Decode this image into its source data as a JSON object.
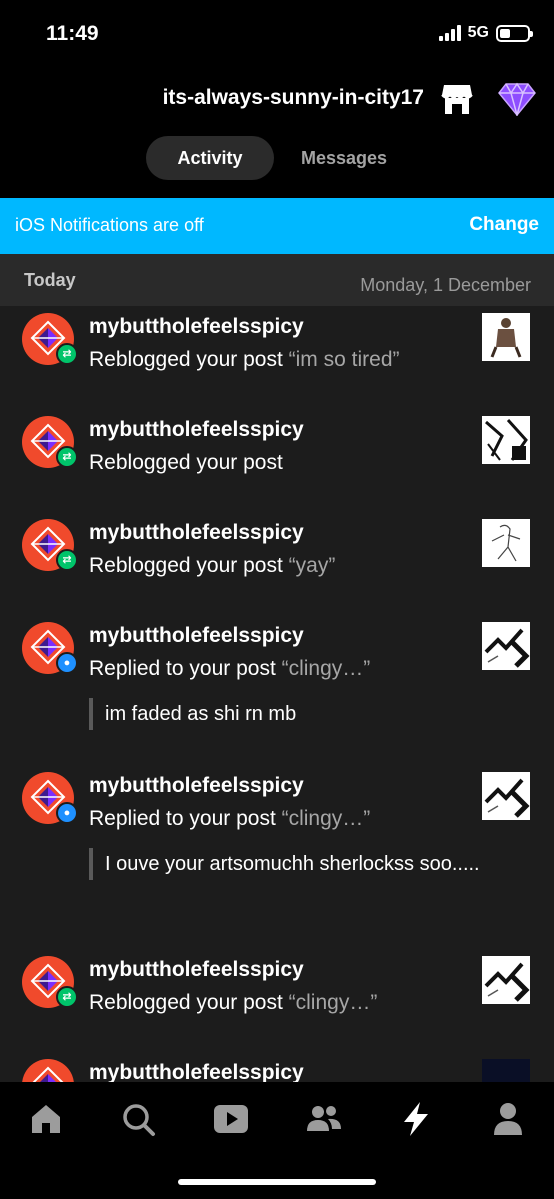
{
  "status_bar": {
    "time": "11:49",
    "network": "5G"
  },
  "header": {
    "blog_name": "its-always-sunny-in-city17",
    "shop_icon": "shop-icon",
    "premium_icon": "gem-icon"
  },
  "tabs": [
    {
      "label": "Activity",
      "active": true
    },
    {
      "label": "Messages",
      "active": false
    }
  ],
  "notifications_banner": {
    "text": "iOS Notifications are off",
    "action": "Change"
  },
  "activity": {
    "day_label": "Today",
    "date_label": "Monday, 1 December",
    "items": [
      {
        "username": "mybuttholefeelsspicy",
        "type": "reblog",
        "action": "Reblogged your post ",
        "quote": "“im so tired”"
      },
      {
        "username": "mybuttholefeelsspicy",
        "type": "reblog",
        "action": "Reblogged your post",
        "quote": ""
      },
      {
        "username": "mybuttholefeelsspicy",
        "type": "reblog",
        "action": "Reblogged your post ",
        "quote": "“yay”"
      },
      {
        "username": "mybuttholefeelsspicy",
        "type": "reply",
        "action": "Replied to your post ",
        "quote": "“clingy…”",
        "reply": "im faded as shi rn mb"
      },
      {
        "username": "mybuttholefeelsspicy",
        "type": "reply",
        "action": "Replied to your post ",
        "quote": "“clingy…”",
        "reply": "I ouve your artsomuchh sherlockss soo....."
      },
      {
        "username": "mybuttholefeelsspicy",
        "type": "reblog",
        "action": "Reblogged your post ",
        "quote": "“clingy…”"
      },
      {
        "username": "mybuttholefeelsspicy",
        "type": "reblog",
        "action": "",
        "quote": ""
      }
    ]
  },
  "bottom_nav": [
    "home-icon",
    "search-icon",
    "video-icon",
    "communities-icon",
    "activity-icon",
    "account-icon"
  ],
  "colors": {
    "banner": "#00b8ff",
    "avatar": "#f04a2c",
    "reblog_badge": "#00c46a",
    "reply_badge": "#1e90ff"
  }
}
